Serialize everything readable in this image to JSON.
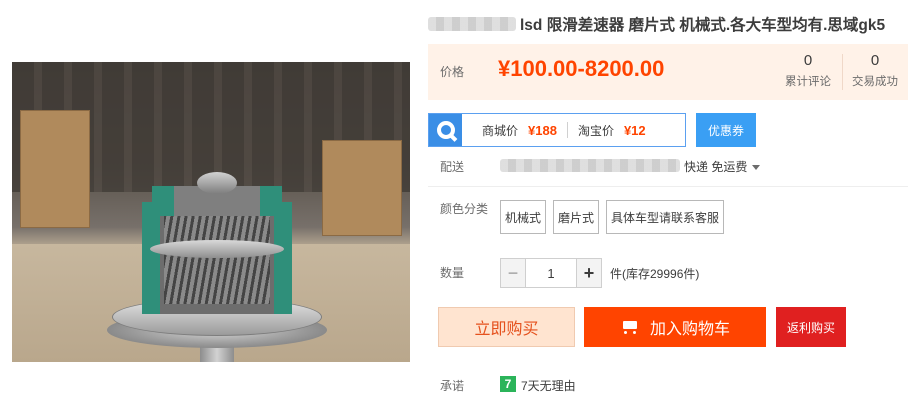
{
  "product": {
    "title": "lsd 限滑差速器 磨片式 机械式.各大车型均有.思域gk5"
  },
  "price": {
    "label": "价格",
    "value": "¥100.00-8200.00",
    "reviews_count": "0",
    "reviews_label": "累计评论",
    "sales_count": "0",
    "sales_label": "交易成功",
    "accent_color": "#ff4400",
    "panel_color": "#fff2e8"
  },
  "compare": {
    "icon": "search-icon",
    "mall_label": "商城价",
    "mall_price": "¥188",
    "taobao_label": "淘宝价",
    "taobao_price": "¥12",
    "coupon_label": "优惠券"
  },
  "shipping": {
    "label": "配送",
    "method": "快递 免运费"
  },
  "options": {
    "label": "颜色分类",
    "items": [
      "机械式",
      "磨片式",
      "具体车型请联系客服"
    ]
  },
  "quantity": {
    "label": "数量",
    "minus": "−",
    "value": "1",
    "plus": "+",
    "stock_text": "件(库存29996件)"
  },
  "actions": {
    "buy_now": "立即购买",
    "add_to_cart": "加入购物车",
    "rebate": "返利购买"
  },
  "promise": {
    "label": "承诺",
    "badge": "7",
    "text": "7天无理由"
  }
}
